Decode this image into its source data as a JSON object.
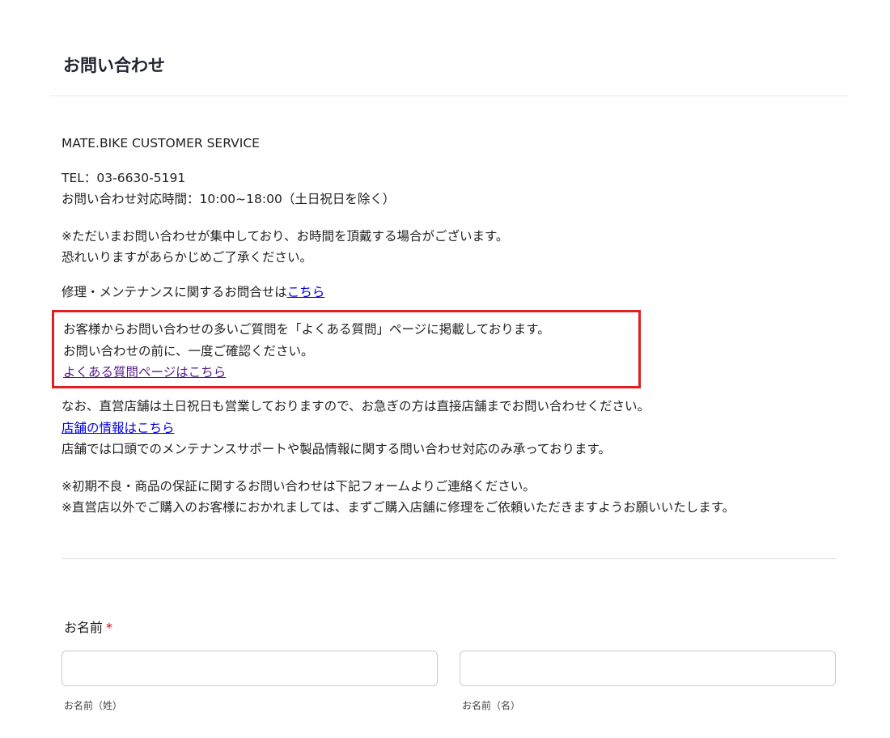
{
  "page": {
    "title": "お問い合わせ"
  },
  "intro": {
    "company": "MATE.BIKE CUSTOMER SERVICE",
    "tel": "TEL：03-6630-5191",
    "hours": "お問い合わせ対応時間：10:00~18:00（土日祝日を除く）",
    "notice_line1": "※ただいまお問い合わせが集中しており、お時間を頂戴する場合がございます。",
    "notice_line2": "恐れいりますがあらかじめご了承ください。",
    "repair_text": "修理・メンテナンスに関するお問合せは",
    "repair_link": "こちら"
  },
  "faq": {
    "line1": "お客様からお問い合わせの多いご質問を「よくある質問」ページに掲載しております。",
    "line2": "お問い合わせの前に、一度ご確認ください。",
    "link": "よくある質問ページはこちら"
  },
  "stores": {
    "line1": "なお、直営店舗は土日祝日も営業しておりますので、お急ぎの方は直接店舗までお問い合わせください。",
    "link": "店舗の情報はこちら",
    "line2": "店舗では口頭でのメンテナンスサポートや製品情報に関する問い合わせ対応のみ承っております。"
  },
  "notes": {
    "line1": "※初期不良・商品の保証に関するお問い合わせは下記フォームよりご連絡ください。",
    "line2": "※直営店以外でご購入のお客様におかれましては、まずご購入店舗に修理をご依頼いただきますようお願いいたします。"
  },
  "form": {
    "name_label": "お名前",
    "required_mark": "*",
    "last_name": {
      "value": "",
      "sub_label": "お名前（姓）"
    },
    "first_name": {
      "value": "",
      "sub_label": "お名前（名）"
    }
  },
  "colors": {
    "link": "#0000ee",
    "visited_link": "#551a8b",
    "highlight_border": "#e02020",
    "required": "#d0021b"
  }
}
